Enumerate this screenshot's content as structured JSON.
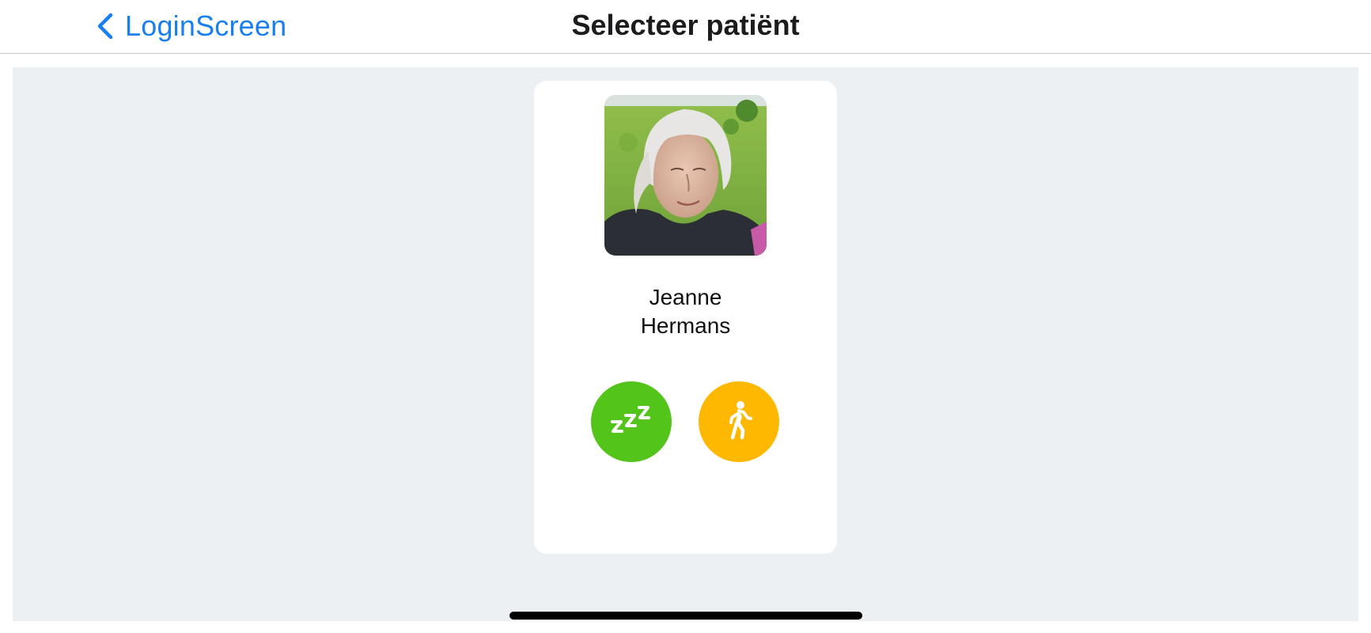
{
  "nav": {
    "back_label": "LoginScreen",
    "title": "Selecteer patiënt",
    "accent_color": "#1a7ff0"
  },
  "patient": {
    "first_name": "Jeanne",
    "last_name": "Hermans",
    "photo": "patient-portrait-photo",
    "statuses": [
      {
        "name": "sleep",
        "icon": "zzz-icon",
        "color": "#52c41a"
      },
      {
        "name": "activity",
        "icon": "walking-person-icon",
        "color": "#ffb800"
      }
    ]
  },
  "colors": {
    "background": "#edf0f2",
    "card": "#ffffff"
  }
}
